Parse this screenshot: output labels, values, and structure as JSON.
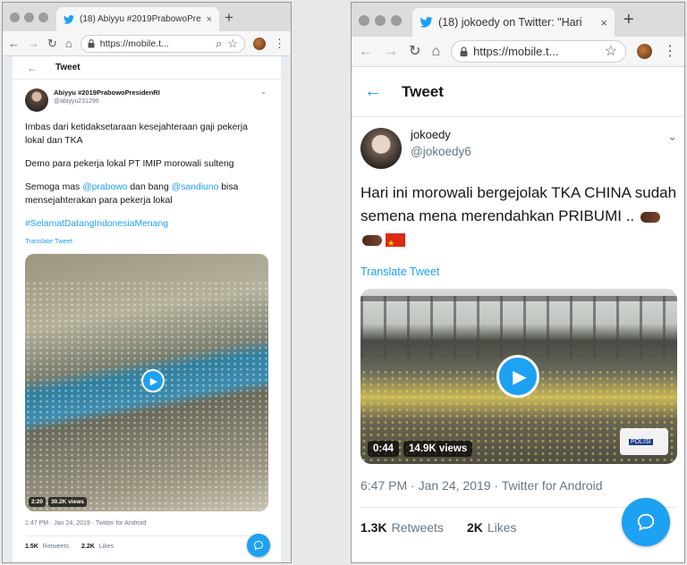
{
  "left": {
    "tab_title": "(18) Abiyyu #2019PrabowoPre...",
    "tab_close": "×",
    "new_tab": "+",
    "url": "https://mobile.t...",
    "header_title": "Tweet",
    "author_name": "Abiyyu #2019PrabowoPresidenRI",
    "author_handle": "@abiyyu231299",
    "text_line1": "Imbas dari ketidaksetaraan kesejahteraan gaji pekerja lokal dan TKA",
    "text_line2": "Demo para pekerja lokal PT IMIP morowali sulteng",
    "text_line3_a": "Semoga mas ",
    "mention1": "@prabowo",
    "text_line3_b": " dan bang ",
    "mention2": "@sandiuno",
    "text_line3_c": " bisa mensejahterakan para pekerja lokal",
    "hashtag": "#SelamatDatangIndonesiaMenang",
    "translate": "Translate Tweet",
    "video_duration": "2:20",
    "video_views": "30.2K views",
    "meta": "1:47 PM · Jan 24, 2019 · Twitter for Android",
    "retweets_count": "1.5K",
    "retweets_label": "Retweets",
    "likes_count": "2.2K",
    "likes_label": "Likes"
  },
  "right": {
    "tab_title": "(18) jokoedy on Twitter: \"Hari",
    "tab_close": "×",
    "new_tab": "+",
    "url": "https://mobile.t...",
    "header_title": "Tweet",
    "author_name": "jokoedy",
    "author_handle": "@jokoedy6",
    "text": "Hari ini morowali bergejolak TKA CHINA sudah semena mena merendahkan PRIBUMI ..",
    "translate": "Translate Tweet",
    "video_duration": "0:44",
    "video_views": "14.9K views",
    "police_label": "POLISI",
    "meta": "6:47 PM · Jan 24, 2019 · Twitter for Android",
    "retweets_count": "1.3K",
    "retweets_label": "Retweets",
    "likes_count": "2K",
    "likes_label": "Likes"
  },
  "icons": {
    "back": "←",
    "forward": "→",
    "reload": "↻",
    "home": "⌂",
    "lock": "🔒",
    "search": "⌕",
    "star": "☆",
    "menu": "⋮",
    "chevron": "⌄",
    "play": "▶",
    "compose": "✎"
  },
  "colors": {
    "accent": "#1da1f2",
    "text": "#14171a",
    "muted": "#657786"
  }
}
